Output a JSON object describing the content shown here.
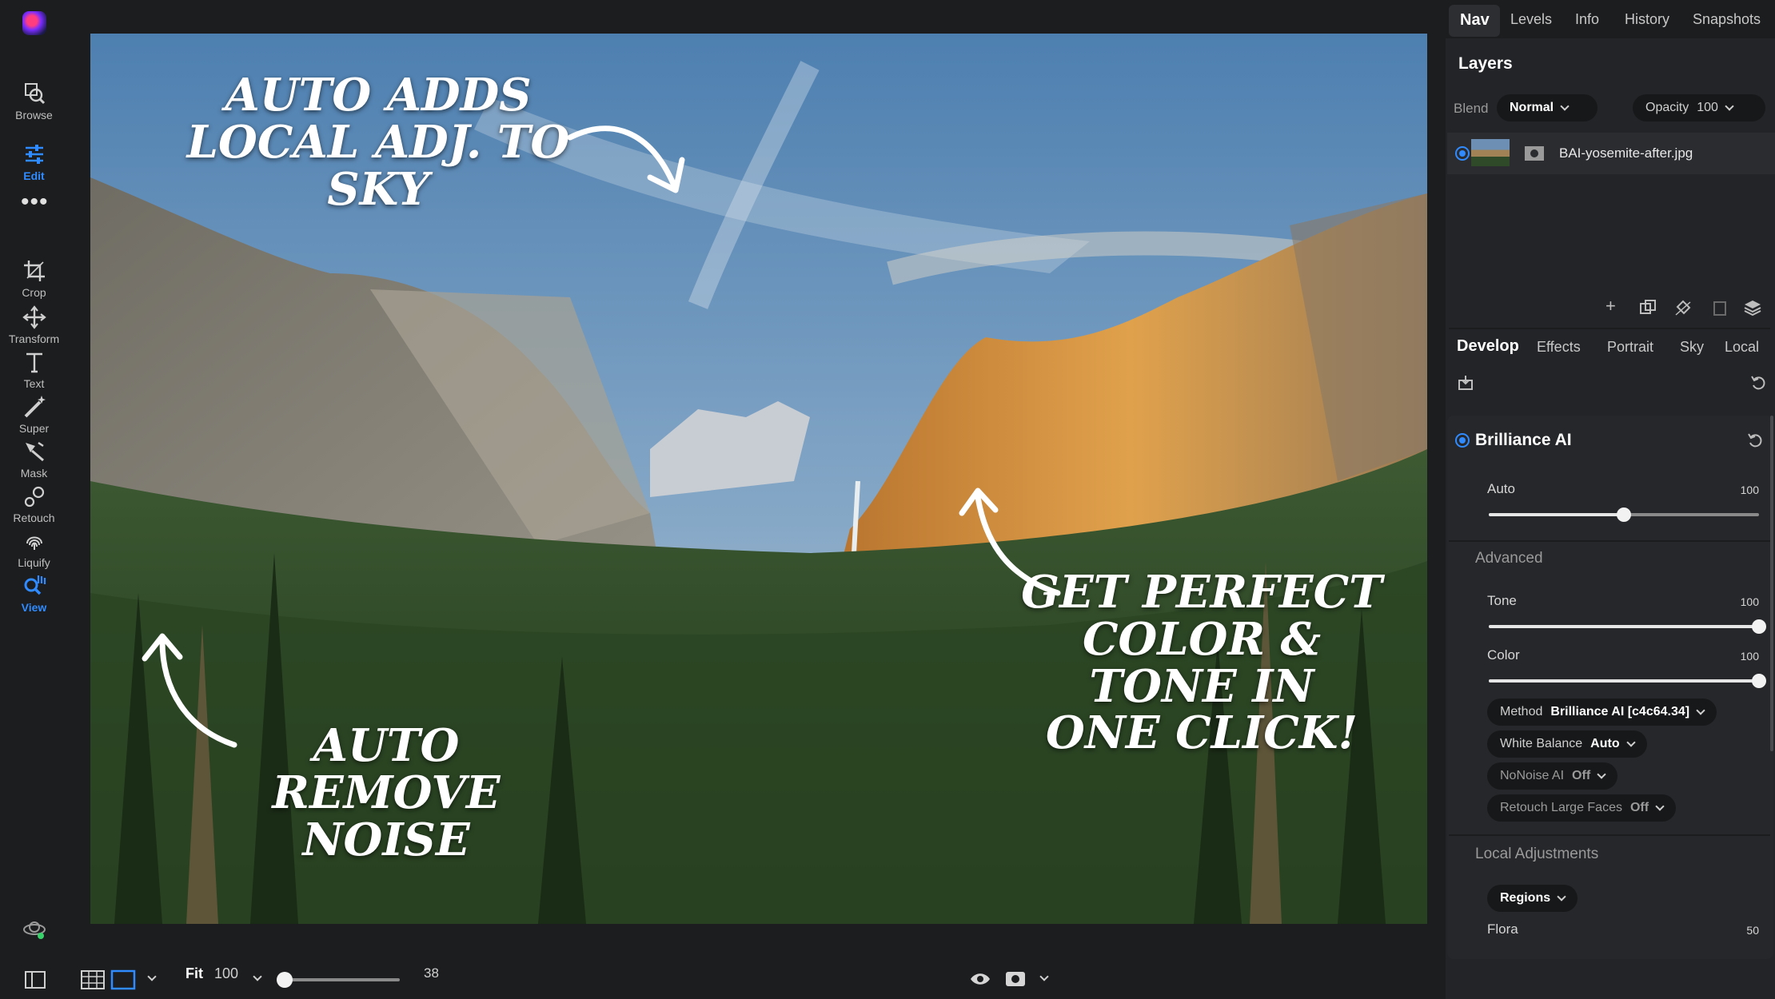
{
  "rail": {
    "tools": [
      {
        "label": "Browse",
        "icon": "browse-icon"
      },
      {
        "label": "Edit",
        "icon": "sliders-icon"
      },
      {
        "label": "Crop",
        "icon": "crop-icon"
      },
      {
        "label": "Transform",
        "icon": "move-icon"
      },
      {
        "label": "Text",
        "icon": "text-icon"
      },
      {
        "label": "Super",
        "icon": "magic-wand-icon"
      },
      {
        "label": "Mask",
        "icon": "mask-brush-icon"
      },
      {
        "label": "Retouch",
        "icon": "retouch-icon"
      },
      {
        "label": "Liquify",
        "icon": "fingerprint-icon"
      },
      {
        "label": "View",
        "icon": "view-hand-icon"
      }
    ],
    "accent": "#2f8bff"
  },
  "annotations": {
    "sky": [
      "AUTO ADDS",
      "LOCAL ADJ. TO SKY"
    ],
    "tone": [
      "GET PERFECT",
      "COLOR & TONE IN",
      "ONE CLICK!"
    ],
    "noise": [
      "AUTO REMOVE",
      "NOISE"
    ]
  },
  "bottombar": {
    "fit_label": "Fit",
    "zoom_value": "100",
    "slider_value": "38"
  },
  "top_tabs": [
    "Nav",
    "Levels",
    "Info",
    "History",
    "Snapshots"
  ],
  "layers": {
    "title": "Layers",
    "blend_label": "Blend",
    "blend_value": "Normal",
    "opacity_label": "Opacity",
    "opacity_value": "100",
    "file_name": "BAI-yosemite-after.jpg"
  },
  "develop_tabs": [
    "Develop",
    "Effects",
    "Portrait",
    "Sky",
    "Local"
  ],
  "brilliance": {
    "title": "Brilliance AI",
    "auto_label": "Auto",
    "auto_value": "100",
    "auto_fraction": 0.5,
    "advanced_label": "Advanced",
    "tone_label": "Tone",
    "tone_value": "100",
    "tone_fraction": 1.0,
    "color_label": "Color",
    "color_value": "100",
    "color_fraction": 1.0,
    "method_label": "Method",
    "method_value": "Brilliance AI [c4c64.34]",
    "wb_label": "White Balance",
    "wb_value": "Auto",
    "nonoise_label": "NoNoise AI",
    "nonoise_value": "Off",
    "faces_label": "Retouch Large Faces",
    "faces_value": "Off"
  },
  "local_adj": {
    "title": "Local Adjustments",
    "regions_label": "Regions",
    "flora_label": "Flora",
    "flora_value": "50"
  }
}
